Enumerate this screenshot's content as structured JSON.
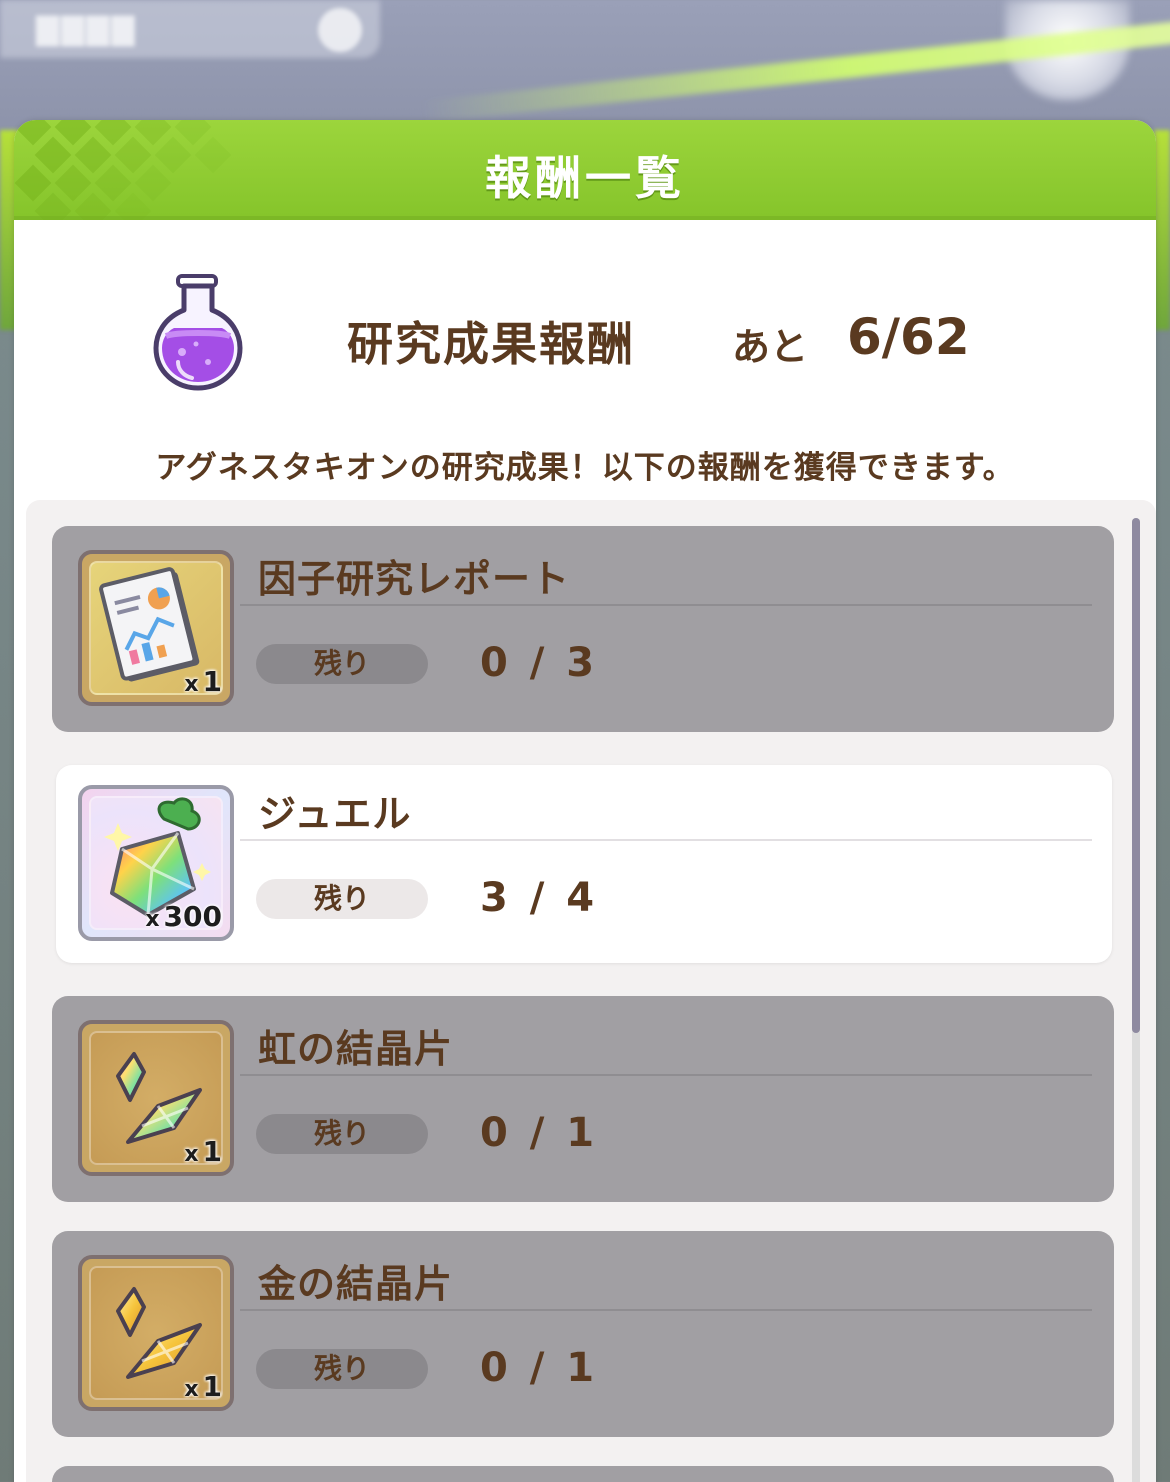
{
  "dialog": {
    "title": "報酬一覧",
    "summary_label": "研究成果報酬",
    "remaining_prefix": "あと",
    "remaining_value": "6/62",
    "description": "アグネスタキオンの研究成果！以下の報酬を獲得できます。"
  },
  "rewards": [
    {
      "name": "因子研究レポート",
      "qty_prefix": "x",
      "qty": "1",
      "remain_label": "残り",
      "count": "0 / 3",
      "state": "done"
    },
    {
      "name": "ジュエル",
      "qty_prefix": "x",
      "qty": "300",
      "remain_label": "残り",
      "count": "3 / 4",
      "state": "active"
    },
    {
      "name": "虹の結晶片",
      "qty_prefix": "x",
      "qty": "1",
      "remain_label": "残り",
      "count": "0 / 1",
      "state": "done"
    },
    {
      "name": "金の結晶片",
      "qty_prefix": "x",
      "qty": "1",
      "remain_label": "残り",
      "count": "0 / 1",
      "state": "done"
    }
  ],
  "colors": {
    "header_green": "#8fcd31",
    "text_brown": "#5a3a20",
    "done_card": "#a19fa3",
    "active_card": "#ffffff"
  }
}
